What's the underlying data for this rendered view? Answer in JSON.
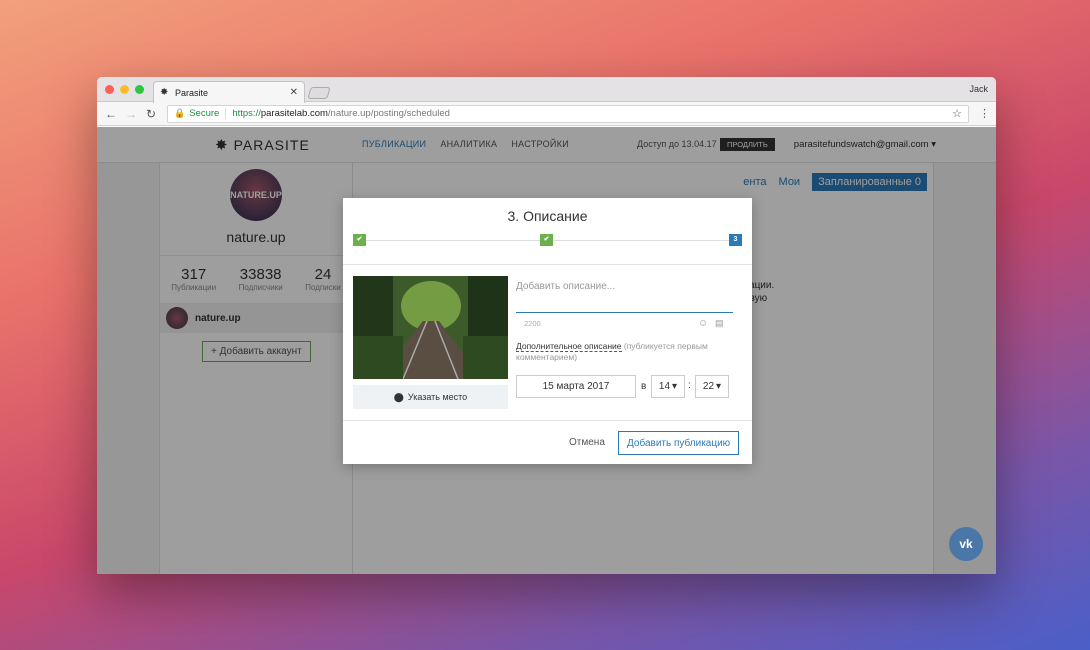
{
  "browser": {
    "tab_title": "Parasite",
    "user": "Jack",
    "secure_label": "Secure",
    "url_scheme": "https://",
    "url_host": "parasitelab.com",
    "url_path": "/nature.up/posting/scheduled"
  },
  "site": {
    "logo": "PARASITE",
    "nav": [
      "ПУБЛИКАЦИИ",
      "АНАЛИТИКА",
      "НАСТРОЙКИ"
    ],
    "access_text": "Доступ до 13.04.17",
    "prolong_label": "ПРОДЛИТЬ",
    "account_email": "parasitefundswatch@gmail.com ▾"
  },
  "profile": {
    "avatar_text": "NATURE.UP",
    "name": "nature.up",
    "stats": [
      {
        "value": "317",
        "label": "Публикации"
      },
      {
        "value": "33838",
        "label": "Подписчики"
      },
      {
        "value": "24",
        "label": "Подписки"
      }
    ],
    "account_item": "nature.up",
    "add_account": "+ Добавить аккаунт"
  },
  "main": {
    "tab_client": "ента",
    "tab_mine": "Мои",
    "tab_scheduled": "Запланированные 0",
    "hint_line1": "ликации.",
    "hint_line2": "первую"
  },
  "modal": {
    "title": "3. Описание",
    "steps": [
      "✔",
      "✔",
      "3"
    ],
    "place_label": "Указать место",
    "description_placeholder": "Добавить описание...",
    "char_count": "2200",
    "extra_desc_link": "Дополнительное описание",
    "extra_desc_hint": "(публикуется первым комментарием)",
    "date": "15 марта 2017",
    "at_label": "в",
    "hour": "14",
    "minute": "22",
    "cancel": "Отмена",
    "submit": "Добавить публикацию"
  },
  "icons": {
    "vk": "vk-icon",
    "location": "location-pin-icon"
  },
  "colors": {
    "accent": "#2a7ab8",
    "step_done": "#6ab04c",
    "vk": "#4a76a8"
  }
}
